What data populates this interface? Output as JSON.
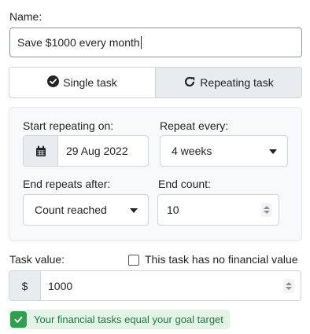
{
  "name": {
    "label": "Name:",
    "value": "Save $1000 every month"
  },
  "task_type": {
    "single_label": "Single task",
    "repeating_label": "Repeating task",
    "selected": "Single task"
  },
  "repeat": {
    "start_label": "Start repeating on:",
    "start_date": "29 Aug 2022",
    "every_label": "Repeat every:",
    "every_value": "4 weeks",
    "end_label": "End repeats after:",
    "end_value": "Count reached",
    "count_label": "End count:",
    "count_value": "10"
  },
  "task_value": {
    "label": "Task value:",
    "no_value_label": "This task has no financial value",
    "no_value_checked": false,
    "currency_symbol": "$",
    "value": "1000"
  },
  "status": {
    "message": "Your financial tasks equal your goal target",
    "color": "#2f9e4f"
  },
  "icons": {
    "single": "check-circle-icon",
    "repeating": "redo-icon",
    "calendar": "calendar-icon",
    "success": "check-icon"
  }
}
